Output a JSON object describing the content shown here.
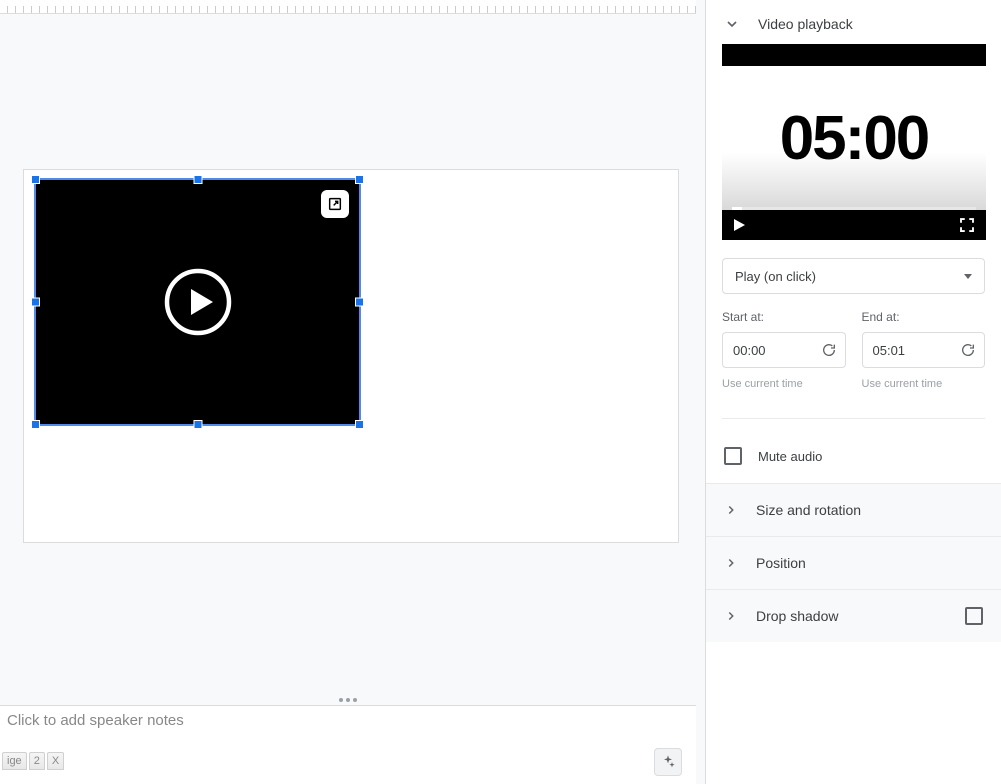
{
  "ruler": {},
  "video": {
    "big_time": "05:00"
  },
  "sidebar": {
    "playback_title": "Video playback",
    "play_mode": "Play (on click)",
    "start": {
      "label": "Start at:",
      "value": "00:00",
      "helper": "Use current time"
    },
    "end": {
      "label": "End at:",
      "value": "05:01",
      "helper": "Use current time"
    },
    "mute_label": "Mute audio",
    "sections": {
      "size": "Size and rotation",
      "position": "Position",
      "dropshadow": "Drop shadow"
    }
  },
  "speaker_notes_placeholder": "Click to add speaker notes",
  "tabs": {
    "t1": "ige",
    "t2": "2",
    "t3": "X"
  }
}
